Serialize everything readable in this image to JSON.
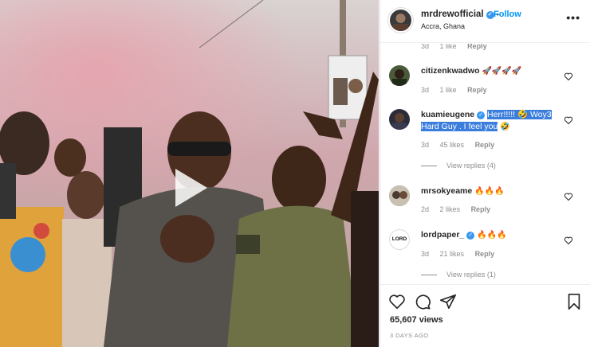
{
  "post": {
    "username": "mrdrewofficial",
    "verified_mark": "✓",
    "separator": "•",
    "follow_label": "Follow",
    "location": "Accra, Ghana",
    "more_label": "•••"
  },
  "comments": {
    "partial": {
      "age": "3d",
      "likes": "1 like",
      "reply": "Reply"
    },
    "items": [
      {
        "user": "citizenkwadwo",
        "text": "🚀🚀🚀🚀",
        "age": "3d",
        "likes": "1 like",
        "reply": "Reply",
        "avatar_color": "#4a5a3a"
      },
      {
        "user": "kuamieugene",
        "text_hl": "Herr!!!!! 🤣 Woy3 Hard Guy . I feel you",
        "text_tail": " 🤣",
        "age": "3d",
        "likes": "45 likes",
        "reply": "Reply",
        "view_replies": "View replies (4)",
        "avatar_color": "#2b2b3a"
      },
      {
        "user": "mrsokyeame",
        "text": "🔥🔥🔥",
        "age": "2d",
        "likes": "2 likes",
        "reply": "Reply",
        "avatar_color": "#6a6a6a"
      },
      {
        "user": "lordpaper_",
        "text": "🔥🔥🔥",
        "age": "3d",
        "likes": "21 likes",
        "reply": "Reply",
        "view_replies": "View replies (1)",
        "avatar_text": "LORD",
        "avatar_color": "#ffffff"
      }
    ]
  },
  "footer": {
    "views": "65,607 views",
    "posted": "3 DAYS AGO"
  },
  "icons": [
    "play-icon",
    "verified-icon",
    "more-icon",
    "heart-icon",
    "comment-icon",
    "share-icon",
    "bookmark-icon"
  ],
  "colors": {
    "link": "#0095f6",
    "verified": "#3897f0",
    "highlight": "#3b7ddd",
    "muted": "#8e8e8e"
  }
}
